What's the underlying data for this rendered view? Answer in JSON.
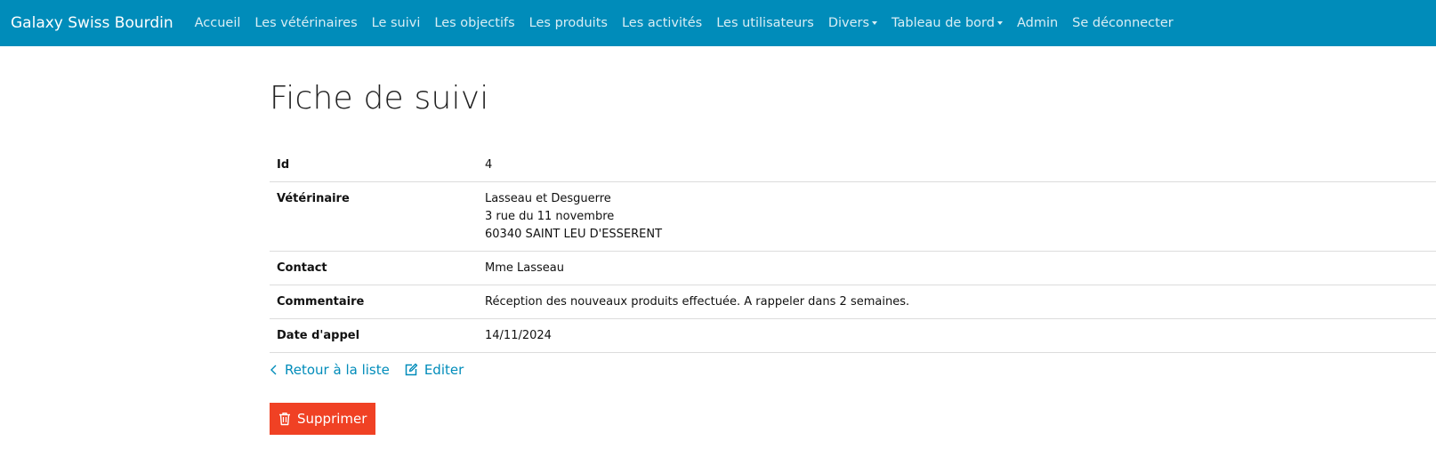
{
  "navbar": {
    "brand": "Galaxy Swiss Bourdin",
    "items": [
      {
        "label": "Accueil"
      },
      {
        "label": "Les vétérinaires"
      },
      {
        "label": "Le suivi"
      },
      {
        "label": "Les objectifs"
      },
      {
        "label": "Les produits"
      },
      {
        "label": "Les activités"
      },
      {
        "label": "Les utilisateurs"
      },
      {
        "label": "Divers"
      },
      {
        "label": "Tableau de bord"
      },
      {
        "label": "Admin"
      },
      {
        "label": "Se déconnecter"
      }
    ],
    "background": "#008cba"
  },
  "page": {
    "title": "Fiche de suivi"
  },
  "detail": {
    "rows": [
      {
        "label": "Id",
        "value": "4"
      },
      {
        "label": "Vétérinaire",
        "lines": [
          "Lasseau et Desguerre",
          "3 rue du 11 novembre",
          "60340 SAINT LEU D'ESSERENT"
        ]
      },
      {
        "label": "Contact",
        "value": "Mme Lasseau"
      },
      {
        "label": "Commentaire",
        "value": "Réception des nouveaux produits effectuée. A rappeler dans 2 semaines."
      },
      {
        "label": "Date d'appel",
        "value": "14/11/2024"
      }
    ]
  },
  "actions": {
    "back_label": "Retour à la liste",
    "edit_label": "Editer",
    "delete_label": "Supprimer",
    "link_color": "#008cba",
    "danger_color": "#f04124"
  }
}
